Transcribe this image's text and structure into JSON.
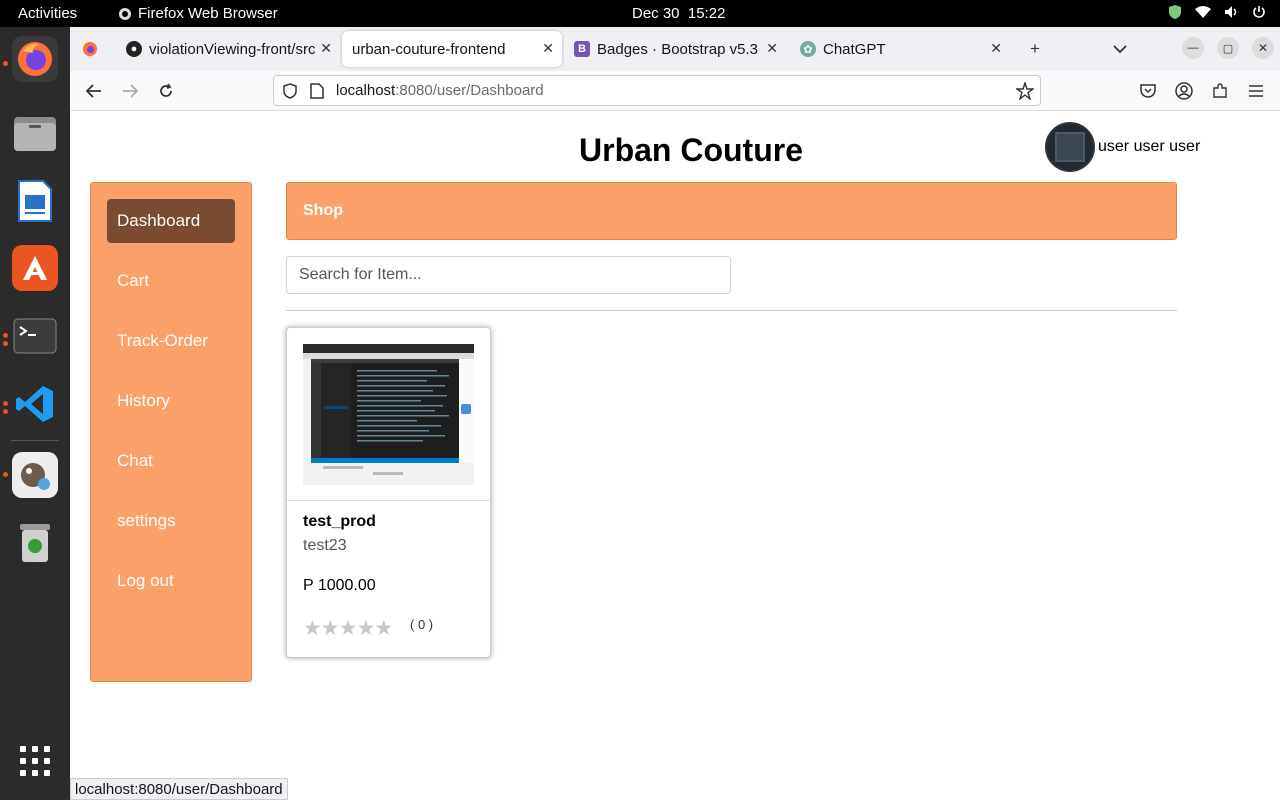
{
  "system": {
    "activities": "Activities",
    "app_name": "Firefox Web Browser",
    "date": "Dec 30",
    "time": "15:22"
  },
  "dock": {
    "items": [
      {
        "name": "Firefox",
        "icon": "firefox-icon"
      },
      {
        "name": "Files",
        "icon": "files-icon"
      },
      {
        "name": "LibreOffice Writer",
        "icon": "writer-icon"
      },
      {
        "name": "Ubuntu Software",
        "icon": "software-icon"
      },
      {
        "name": "Terminal",
        "icon": "terminal-icon"
      },
      {
        "name": "Visual Studio Code",
        "icon": "vscode-icon"
      },
      {
        "name": "GIMP",
        "icon": "gimp-icon"
      },
      {
        "name": "Trash",
        "icon": "trash-icon"
      },
      {
        "name": "Show Applications",
        "icon": "grid-icon"
      }
    ]
  },
  "browser": {
    "tabs": [
      {
        "label": "violationViewing-front/src",
        "icon": "github-icon",
        "active": false
      },
      {
        "label": "urban-couture-frontend",
        "icon": "",
        "active": true
      },
      {
        "label": "Badges · Bootstrap v5.3",
        "icon": "bootstrap-icon",
        "active": false
      },
      {
        "label": "ChatGPT",
        "icon": "chatgpt-icon",
        "active": false
      }
    ],
    "url_host": "localhost",
    "url_path": ":8080/user/Dashboard",
    "status_url": "localhost:8080/user/Dashboard"
  },
  "app": {
    "title": "Urban Couture",
    "username": "user user user",
    "sidebar": [
      {
        "label": "Dashboard",
        "active": true
      },
      {
        "label": "Cart",
        "active": false
      },
      {
        "label": "Track-Order",
        "active": false
      },
      {
        "label": "History",
        "active": false
      },
      {
        "label": "Chat",
        "active": false
      },
      {
        "label": "settings",
        "active": false
      },
      {
        "label": "Log out",
        "active": false
      }
    ],
    "section_title": "Shop",
    "search_placeholder": "Search for Item...",
    "products": [
      {
        "name": "test_prod",
        "description": "test23",
        "price": "P 1000.00",
        "rating": 0,
        "stars_max": 5,
        "review_count": "( 0 )"
      }
    ]
  },
  "colors": {
    "accent": "#fca06a",
    "active_item": "#7a4a33"
  }
}
